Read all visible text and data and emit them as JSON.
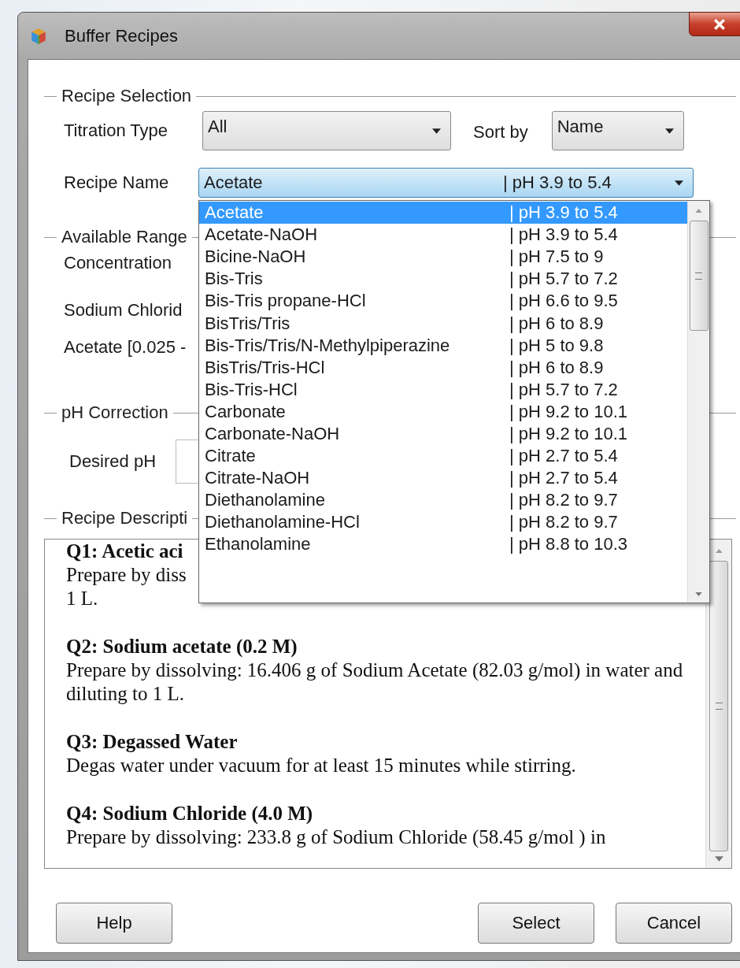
{
  "window": {
    "title": "Buffer Recipes"
  },
  "recipe_selection": {
    "legend": "Recipe Selection",
    "titration_type": {
      "label": "Titration Type",
      "value": "All"
    },
    "sort_by": {
      "label": "Sort by",
      "value": "Name"
    },
    "recipe_name": {
      "label": "Recipe Name",
      "name": "Acetate",
      "range": "|  pH 3.9 to 5.4",
      "expanded": true
    }
  },
  "recipe_list": [
    {
      "name": "Acetate",
      "range": "| pH 3.9 to 5.4",
      "selected": true
    },
    {
      "name": "Acetate-NaOH",
      "range": "| pH 3.9 to 5.4",
      "selected": false
    },
    {
      "name": "Bicine-NaOH",
      "range": "| pH 7.5 to 9",
      "selected": false
    },
    {
      "name": "Bis-Tris",
      "range": "| pH 5.7 to 7.2",
      "selected": false
    },
    {
      "name": "Bis-Tris propane-HCl",
      "range": "| pH 6.6 to 9.5",
      "selected": false
    },
    {
      "name": "BisTris/Tris",
      "range": "| pH 6 to 8.9",
      "selected": false
    },
    {
      "name": "Bis-Tris/Tris/N-Methylpiperazine",
      "range": "| pH 5 to 9.8",
      "selected": false
    },
    {
      "name": "BisTris/Tris-HCl",
      "range": "| pH 6 to 8.9",
      "selected": false
    },
    {
      "name": "Bis-Tris-HCl",
      "range": "| pH 5.7 to 7.2",
      "selected": false
    },
    {
      "name": "Carbonate",
      "range": "| pH 9.2 to 10.1",
      "selected": false
    },
    {
      "name": "Carbonate-NaOH",
      "range": "| pH 9.2 to 10.1",
      "selected": false
    },
    {
      "name": "Citrate",
      "range": "| pH 2.7 to 5.4",
      "selected": false
    },
    {
      "name": "Citrate-NaOH",
      "range": "| pH 2.7 to 5.4",
      "selected": false
    },
    {
      "name": "Diethanolamine",
      "range": "| pH 8.2 to 9.7",
      "selected": false
    },
    {
      "name": "Diethanolamine-HCl",
      "range": "| pH 8.2 to 9.7",
      "selected": false
    },
    {
      "name": "Ethanolamine",
      "range": "| pH 8.8 to 10.3",
      "selected": false
    }
  ],
  "available_range": {
    "legend": "Available Range",
    "labels": [
      "Concentration",
      "Sodium Chlorid",
      "Acetate [0.025 -"
    ]
  },
  "ph_correction": {
    "legend": "pH Correction",
    "desired_ph_label": "Desired pH"
  },
  "recipe_description": {
    "legend": "Recipe Descripti",
    "entries": [
      {
        "heading": "Q1: Acetic aci",
        "lines": [
          "Prepare by diss",
          "1 L."
        ]
      },
      {
        "heading": "Q2: Sodium acetate (0.2 M)",
        "lines": [
          "Prepare by dissolving: 16.406 g of Sodium Acetate (82.03 g/mol) in water and diluting to 1 L."
        ]
      },
      {
        "heading": "Q3: Degassed Water",
        "lines": [
          "Degas water under vacuum for at least 15 minutes while stirring."
        ]
      },
      {
        "heading": "Q4: Sodium Chloride (4.0 M)",
        "lines": [
          "Prepare by dissolving: 233.8 g of Sodium Chloride (58.45 g/mol ) in"
        ]
      }
    ]
  },
  "buttons": [
    "Help",
    "Select",
    "Cancel"
  ]
}
